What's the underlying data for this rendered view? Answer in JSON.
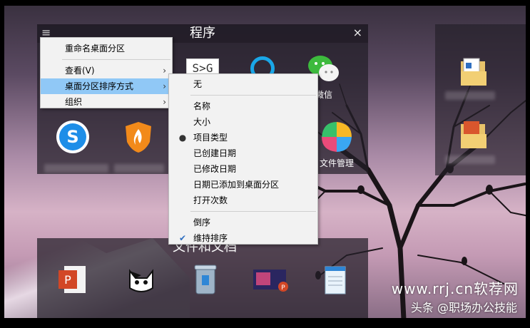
{
  "programs_fence": {
    "title": "程序",
    "close": "×",
    "menu_glyph": "≡",
    "apps": [
      {
        "name": "s-to-g-app",
        "label": ""
      },
      {
        "name": "blue-app",
        "label": ""
      },
      {
        "name": "wechat",
        "label": "微信"
      },
      {
        "name": "sogou-browser",
        "label": ""
      },
      {
        "name": "shield-app",
        "label": ""
      },
      {
        "name": "file-manager",
        "label": "文件管理"
      }
    ]
  },
  "docs_fence": {
    "title": "文件和文档"
  },
  "context_menu": {
    "items": [
      {
        "label": "重命名桌面分区",
        "has_submenu": false
      },
      {
        "label": "查看(V)",
        "has_submenu": true
      },
      {
        "label": "桌面分区排序方式",
        "has_submenu": true,
        "highlighted": true
      },
      {
        "label": "组织",
        "has_submenu": true
      }
    ]
  },
  "sort_submenu": {
    "none": "无",
    "group1": [
      "名称",
      "大小",
      "项目类型",
      "已创建日期",
      "已修改日期",
      "日期已添加到桌面分区",
      "打开次数"
    ],
    "selected_index": 2,
    "reverse": "倒序",
    "keep_sort": "维持排序"
  },
  "watermark": {
    "site": "www.rrj.cn软荐网",
    "author": "头条 @职场办公技能"
  },
  "colors": {
    "menu_bg": "#f2f2f2",
    "highlight": "#90c8f6",
    "fence_bg": "#2a2530"
  }
}
